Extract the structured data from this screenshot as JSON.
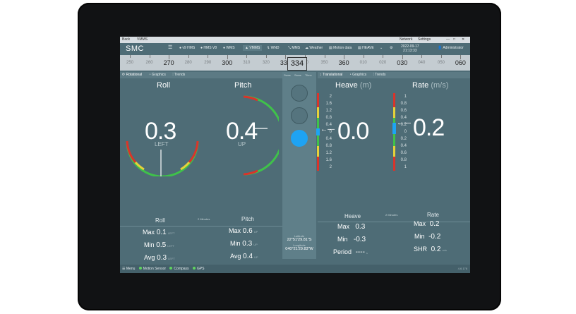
{
  "titlebar": {
    "back": "Back",
    "app": "VMMS",
    "network": "Network",
    "settings": "Settings"
  },
  "nav": {
    "logo": "SMC",
    "items": [
      "v9 HMS",
      "HMS V8",
      "WMS",
      "VMMS",
      "WND",
      "MMS",
      "Weather",
      "Motion data",
      "HEAVE"
    ],
    "active": "VMMS",
    "date": "2022-09-17",
    "time": "21:13:33",
    "user": "Administrator"
  },
  "compass": {
    "labels": [
      "250",
      "260",
      "270",
      "280",
      "290",
      "300",
      "310",
      "320",
      "330",
      "340",
      "350",
      "360",
      "010",
      "020",
      "030",
      "040",
      "050",
      "060"
    ],
    "heading": "334"
  },
  "left_tabs": [
    "Rotational",
    "Graphics",
    "Trends"
  ],
  "mid_tabs": [
    "Swas",
    "Swas",
    "Tilmo"
  ],
  "right_tabs": [
    "Translational",
    "Graphics",
    "Trends"
  ],
  "roll": {
    "title": "Roll",
    "value": "0.3",
    "dir": "LEFT",
    "stats_title": "Roll",
    "max": "0.1",
    "max_dir": "LEFT",
    "min": "0.5",
    "min_dir": "LEFT",
    "avg": "0.3",
    "avg_dir": "LEFT"
  },
  "pitch": {
    "title": "Pitch",
    "value": "0.4",
    "dir": "UP",
    "stats_title": "Pitch",
    "max": "0.6",
    "max_dir": "UP",
    "min": "0.3",
    "min_dir": "UP",
    "avg": "0.4",
    "avg_dir": "UP"
  },
  "period_label": "2 Minutes",
  "labels": {
    "max": "Max",
    "min": "Min",
    "avg": "Avg",
    "period": "Period",
    "shr": "SHR"
  },
  "position": {
    "lat_label": "Latitude",
    "lat": "22°51'29.81\"S",
    "lon_label": "Longitude",
    "lon": "040°21'29.83\"W"
  },
  "heave": {
    "title": "Heave",
    "unit": "(m)",
    "value": "0.0",
    "stats_title": "Heave",
    "max": "0.3",
    "min": "-0.3",
    "period": "----",
    "period_unit": "s"
  },
  "rate": {
    "title": "Rate",
    "unit": "(m/s)",
    "value": "0.2",
    "stats_title": "Rate",
    "max": "0.2",
    "min": "-0.2",
    "shr": "0.2",
    "shr_unit": "m/s"
  },
  "heave_scale": [
    "2",
    "1.6",
    "1.2",
    "0.8",
    "0.4",
    "0",
    "0.4",
    "0.8",
    "1.2",
    "1.6",
    "2"
  ],
  "rate_scale": [
    "1",
    "0.8",
    "0.6",
    "0.4",
    "0.2",
    "0",
    "0.2",
    "0.4",
    "0.6",
    "0.8",
    "1"
  ],
  "status": {
    "menu": "Menu",
    "items": [
      "Motion Sensor",
      "Compass",
      "GPS"
    ],
    "version": "4.6.176"
  },
  "colors": {
    "screen": "#4e6c76",
    "accent": "#1ea3f3",
    "green": "#3fc24a",
    "yellow": "#e6d23a",
    "red": "#d9342b"
  }
}
